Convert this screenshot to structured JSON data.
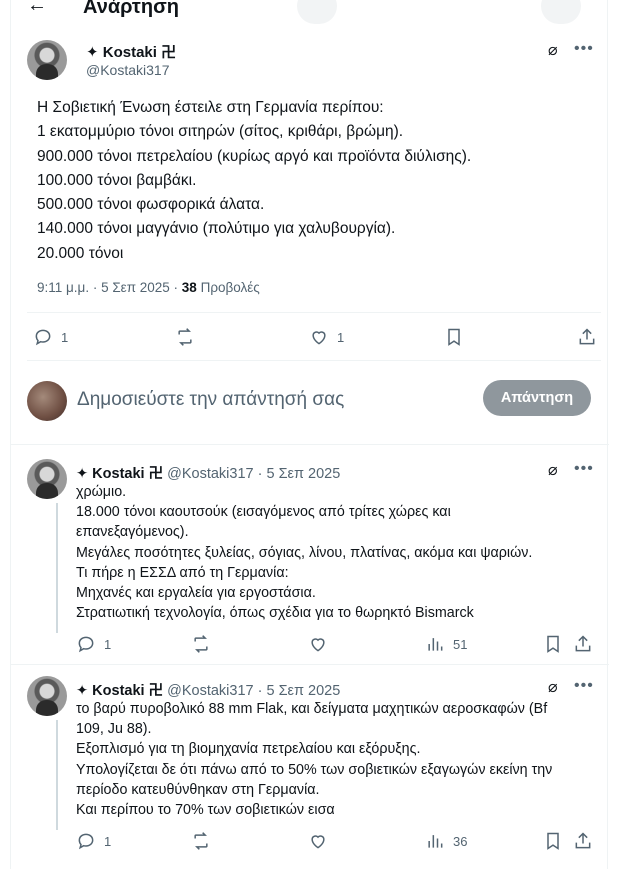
{
  "header": {
    "back_icon": "arrow-left-icon",
    "title": "Ανάρτηση"
  },
  "main_post": {
    "author_name": "✦ Kostaki 卍",
    "handle": "@Kostaki317",
    "lines": [
      "Η Σοβιετική Ένωση έστειλε στη Γερμανία περίπου:",
      "1 εκατομμύριο τόνοι σιτηρών (σίτος, κριθάρι, βρώμη).",
      "900.000 τόνοι πετρελαίου (κυρίως αργό και προϊόντα διύλισης).",
      "100.000 τόνοι βαμβάκι.",
      "500.000 τόνοι φωσφορικά άλατα.",
      "140.000 τόνοι μαγγάνιο (πολύτιμο για χαλυβουργία).",
      "20.000 τόνοι"
    ],
    "timestamp": "9:11 μ.μ. · 5 Σεπ 2025 · ",
    "views_count": "38",
    "views_label": " Προβολές",
    "replies": "1",
    "likes": "1"
  },
  "reply_box": {
    "placeholder": "Δημοσιεύστε την απάντησή σας",
    "button": "Απάντηση"
  },
  "replies": [
    {
      "author_name": "✦ Kostaki 卍",
      "handle_date": " @Kostaki317 · 5 Σεπ 2025",
      "lines": [
        "χρώμιο.",
        "18.000 τόνοι καουτσούκ (εισαγόμενος από τρίτες χώρες και",
        "επανεξαγόμενος).",
        "Μεγάλες ποσότητες ξυλείας, σόγιας, λίνου, πλατίνας, ακόμα και ψαριών.",
        "Τι πήρε η ΕΣΣΔ από τη Γερμανία:",
        "Μηχανές και εργαλεία για εργοστάσια.",
        "Στρατιωτική τεχνολογία, όπως σχέδια για το θωρηκτό Bismarck"
      ],
      "replies": "1",
      "views": "51"
    },
    {
      "author_name": "✦ Kostaki 卍",
      "handle_date": " @Kostaki317 · 5 Σεπ 2025",
      "lines": [
        "το βαρύ πυροβολικό 88 mm Flak, και δείγματα μαχητικών αεροσκαφών (Bf",
        "109, Ju 88).",
        "Εξοπλισμό για τη βιομηχανία πετρελαίου και εξόρυξης.",
        "Υπολογίζεται δε ότι πάνω από το 50% των σοβιετικών εξαγωγών εκείνη την",
        "περίοδο κατευθύνθηκαν στη Γερμανία.",
        "Και περίπου το 70% των σοβιετικών εισα"
      ],
      "replies": "1",
      "views": "36"
    }
  ],
  "icons": {
    "grok": "grok-icon",
    "more": "more-icon",
    "reply": "reply-icon",
    "retweet": "retweet-icon",
    "like": "heart-icon",
    "views": "views-icon",
    "bookmark": "bookmark-icon",
    "share": "share-icon"
  }
}
